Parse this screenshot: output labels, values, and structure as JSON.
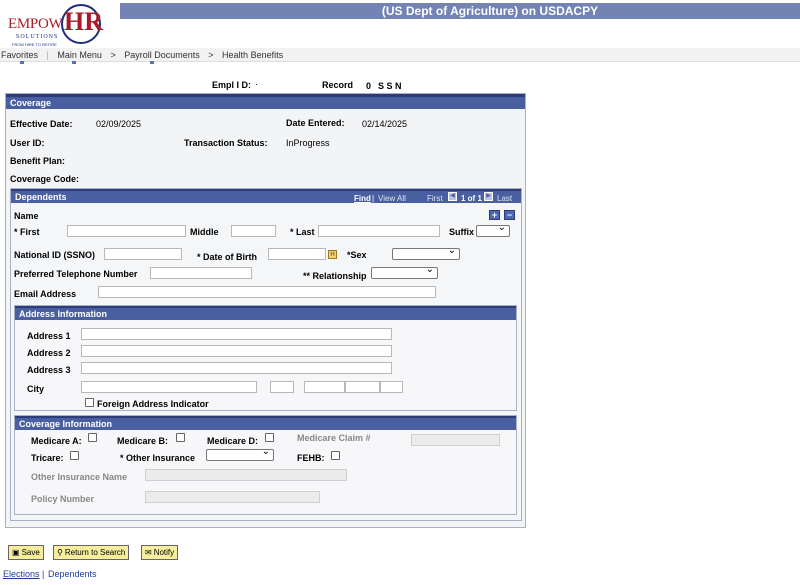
{
  "header": {
    "title": "(US Dept of Agriculture) on USDACPY",
    "logo_main": "EMPOW",
    "logo_hr": "HR",
    "logo_solutions": "SOLUTIONS",
    "logo_tagline": "FROM HIRE TO RETIRE"
  },
  "nav": {
    "items": [
      "Favorites",
      "Main Menu",
      "Payroll Documents",
      "Health Benefits"
    ],
    "sep": ">"
  },
  "top_fields": {
    "empl_id_label": "Empl I D:",
    "empl_id_value": "·",
    "record_label": "Record",
    "record_value": "0",
    "ssn_label": "S S N"
  },
  "coverage": {
    "title": "Coverage",
    "effective_date_label": "Effective Date:",
    "effective_date": "02/09/2025",
    "date_entered_label": "Date Entered:",
    "date_entered": "02/14/2025",
    "user_id_label": "User ID:",
    "transaction_status_label": "Transaction Status:",
    "transaction_status": "InProgress",
    "benefit_plan_label": "Benefit Plan:",
    "coverage_code_label": "Coverage Code:"
  },
  "dependents": {
    "title": "Dependents",
    "find": "Find",
    "view_all": "View All",
    "first": "First",
    "page_info": "1 of 1",
    "last": "Last",
    "name_label": "Name",
    "first_label": "* First",
    "middle_label": "Middle",
    "last_label": "* Last",
    "suffix_label": "Suffix",
    "national_id_label": "National ID (SSNO)",
    "dob_label": "* Date of Birth",
    "sex_label": "*Sex",
    "phone_label": "Preferred Telephone Number",
    "relationship_label": "** Relationship",
    "email_label": "Email Address",
    "add_icon": "+",
    "remove_icon": "−"
  },
  "address": {
    "title": "Address Information",
    "address1_label": "Address 1",
    "address2_label": "Address 2",
    "address3_label": "Address 3",
    "city_label": "City",
    "foreign_label": "Foreign Address Indicator"
  },
  "coverage_info": {
    "title": "Coverage Information",
    "medicare_a_label": "Medicare A:",
    "medicare_b_label": "Medicare B:",
    "medicare_d_label": "Medicare D:",
    "medicare_claim_label": "Medicare Claim #",
    "tricare_label": "Tricare:",
    "other_insurance_label": "* Other Insurance",
    "fehb_label": "FEHB:",
    "other_insurance_name_label": "Other Insurance Name",
    "policy_number_label": "Policy Number"
  },
  "buttons": {
    "save": "Save",
    "return_to_search": "Return to Search",
    "notify": "Notify"
  },
  "footer_links": {
    "elections": "Elections",
    "separator": "|",
    "dependents": "Dependents"
  },
  "colors": {
    "header_band": "#7383b3",
    "panel_header": "#4a5fa0",
    "button_bg": "#f6ee9c",
    "logo_red": "#a61c28",
    "logo_blue": "#1e2f7a"
  }
}
